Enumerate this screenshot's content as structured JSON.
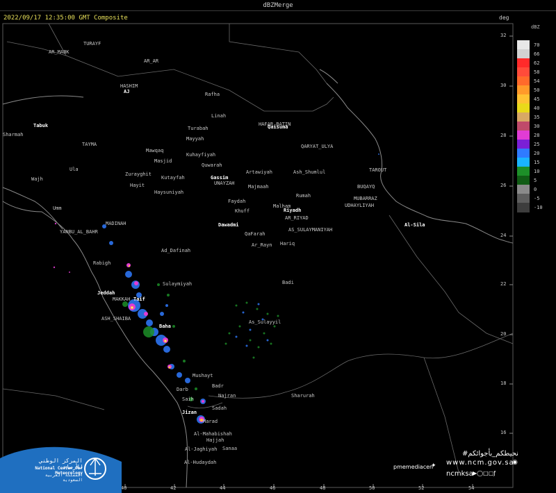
{
  "header": {
    "title": "dBZMerge",
    "timestamp": "2022/09/17 12:35:00 GMT Composite",
    "unit": "deg"
  },
  "colors": {
    "background": "#000000",
    "border": "#5a5a5a",
    "timestamp_text": "#e8e05a",
    "logo_blue": "#1f6fc0"
  },
  "legend": {
    "unit": "dBZ",
    "entries": [
      {
        "label": "70",
        "color": "#e8e8e8"
      },
      {
        "label": "66",
        "color": "#d2d2d2"
      },
      {
        "label": "62",
        "color": "#ff2a2a"
      },
      {
        "label": "58",
        "color": "#ff4b3a"
      },
      {
        "label": "54",
        "color": "#ff6a2b"
      },
      {
        "label": "50",
        "color": "#ff9a2a"
      },
      {
        "label": "45",
        "color": "#ffc233"
      },
      {
        "label": "40",
        "color": "#e9d91a"
      },
      {
        "label": "35",
        "color": "#d8a865"
      },
      {
        "label": "30",
        "color": "#c04a6a"
      },
      {
        "label": "28",
        "color": "#e13cd4"
      },
      {
        "label": "25",
        "color": "#7a1fd6"
      },
      {
        "label": "20",
        "color": "#2f7bff"
      },
      {
        "label": "15",
        "color": "#1ab4ff"
      },
      {
        "label": "10",
        "color": "#1d8f28"
      },
      {
        "label": "5",
        "color": "#115c15"
      },
      {
        "label": "0",
        "color": "#8a8a8a"
      },
      {
        "label": "-5",
        "color": "#5e5e5e"
      },
      {
        "label": "-10",
        "color": "#3d3d3d"
      }
    ]
  },
  "axes": {
    "lat_ticks": [
      "32",
      "30",
      "28",
      "26",
      "24",
      "22",
      "20",
      "18",
      "16"
    ],
    "lon_ticks": [
      "40",
      "42",
      "44",
      "46",
      "48",
      "50",
      "52",
      "54"
    ]
  },
  "places": [
    {
      "name": "TURAYF"
    },
    {
      "name": "AR_MABK"
    },
    {
      "name": "AR_AR"
    },
    {
      "name": "HASHIM"
    },
    {
      "name": "AJ"
    },
    {
      "name": "Rafha"
    },
    {
      "name": "Linah"
    },
    {
      "name": "HAFAR_BATIN"
    },
    {
      "name": "Qaisuma"
    },
    {
      "name": "Turabah"
    },
    {
      "name": "Tabuk"
    },
    {
      "name": "Sharmah"
    },
    {
      "name": "Mayyah"
    },
    {
      "name": "QARYAT_ULYA"
    },
    {
      "name": "TAYMA"
    },
    {
      "name": "Mawqaq"
    },
    {
      "name": "Kuhayfiyah"
    },
    {
      "name": "Masjid"
    },
    {
      "name": "Quwarah"
    },
    {
      "name": "Ula"
    },
    {
      "name": "Artawiyah"
    },
    {
      "name": "Ash_Shumlul"
    },
    {
      "name": "TAROUT"
    },
    {
      "name": "Zurayghit"
    },
    {
      "name": "Kutayfah"
    },
    {
      "name": "Gassim"
    },
    {
      "name": "UNAYZAH"
    },
    {
      "name": "Wajh"
    },
    {
      "name": "Hayit"
    },
    {
      "name": "Majmaah"
    },
    {
      "name": "BUQAYQ"
    },
    {
      "name": "Haysuniyah"
    },
    {
      "name": "Rumah"
    },
    {
      "name": "MUBARRAZ"
    },
    {
      "name": "UDHAYLIYAH"
    },
    {
      "name": "Faydah"
    },
    {
      "name": "Malham"
    },
    {
      "name": "Riyadh"
    },
    {
      "name": "Umm"
    },
    {
      "name": "Khuff"
    },
    {
      "name": "AR_RIYAD"
    },
    {
      "name": "Al-Sila"
    },
    {
      "name": "MADINAH"
    },
    {
      "name": "Dawadmi"
    },
    {
      "name": "YANBU_AL_BAHR"
    },
    {
      "name": "QaFarah"
    },
    {
      "name": "AS_SULAYMANIYAH"
    },
    {
      "name": "Ar_Rayn"
    },
    {
      "name": "Hariq"
    },
    {
      "name": "Ad_Dafinah"
    },
    {
      "name": "Rabigh"
    },
    {
      "name": "Sulaymiyah"
    },
    {
      "name": "Badi"
    },
    {
      "name": "Jeddah"
    },
    {
      "name": "MAKKAH"
    },
    {
      "name": "Taif"
    },
    {
      "name": "ASH_SHAIBA"
    },
    {
      "name": "As_Sulayyil"
    },
    {
      "name": "Baha"
    },
    {
      "name": "Mushayt"
    },
    {
      "name": "Darb"
    },
    {
      "name": "Badr"
    },
    {
      "name": "Najran"
    },
    {
      "name": "Sharurah"
    },
    {
      "name": "Saih"
    },
    {
      "name": "Sadah"
    },
    {
      "name": "Jizan"
    },
    {
      "name": "Hajjah"
    },
    {
      "name": "Al-Mahabishah"
    },
    {
      "name": "Sanaa"
    },
    {
      "name": "Al-Jaghiyah"
    },
    {
      "name": "Al-Hudaydah"
    },
    {
      "name": "Marad"
    }
  ],
  "branding": {
    "org_ar": "المركز الوطني للأرصاد",
    "org_en": "National Center for Meteorology",
    "ministry_ar": "المملكة العربية السعودية",
    "hashtag": "#نحيطكم_بأجوائكم",
    "twitter": "pmemediacen",
    "website": "www.ncm.gov.sa",
    "handle": "ncmksa"
  }
}
